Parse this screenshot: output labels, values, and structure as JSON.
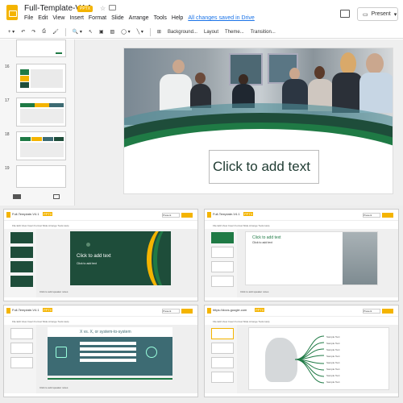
{
  "app": {
    "title": "Full-Template-V4.1",
    "badge": "PPTX",
    "menu": [
      "File",
      "Edit",
      "View",
      "Insert",
      "Format",
      "Slide",
      "Arrange",
      "Tools",
      "Help"
    ],
    "saved_status": "All changes saved in Drive",
    "present_label": "Present"
  },
  "toolbar": {
    "items": [
      "Background...",
      "Layout",
      "Theme...",
      "Transition..."
    ]
  },
  "filmstrip": {
    "numbers": [
      "16",
      "17",
      "18",
      "19"
    ]
  },
  "slide": {
    "placeholder": "Click to add text"
  },
  "quad1": {
    "title": "Full-Template-V4.1",
    "badge": "PPTX",
    "menu": "File Edit View Insert Format Slide Arrange Tools Help",
    "saved": "All changes saved in Drive",
    "present": "Present",
    "slide_title": "Click to add text",
    "slide_sub": "Click to add text",
    "notes": "Click to add speaker notes"
  },
  "quad2": {
    "title": "Full-Template-V4.1",
    "badge": "PPTX",
    "menu": "File Edit View Insert Format Slide Arrange Tools Help",
    "saved": "All changes saved in Drive",
    "present": "Present",
    "slide_title": "Click to add text",
    "slide_sub": "Click to add text",
    "notes": "Click to add speaker notes"
  },
  "quad3": {
    "title": "Full-Template-V4.1",
    "badge": "PPTX",
    "menu": "File Edit View Insert Format Slide Arrange Tools Help",
    "saved": "All changes saved in Drive",
    "present": "Present",
    "slide_title": "X vs. X, or system-to-system",
    "notes": "Click to add speaker notes"
  },
  "quad4": {
    "title": "https://docs.google.com",
    "badge": "PPTX",
    "menu": "File Edit View Insert Format Slide Arrange Tools Help",
    "present": "Present",
    "items": [
      "Sample Text",
      "Sample Text",
      "Sample Text",
      "Sample Text",
      "Sample Text",
      "Sample Text",
      "Sample Text",
      "Sample Text"
    ]
  },
  "colors": {
    "green_dark": "#1e4d3a",
    "green": "#1f7a45",
    "yellow": "#f4b400",
    "teal": "#3d6b73"
  }
}
